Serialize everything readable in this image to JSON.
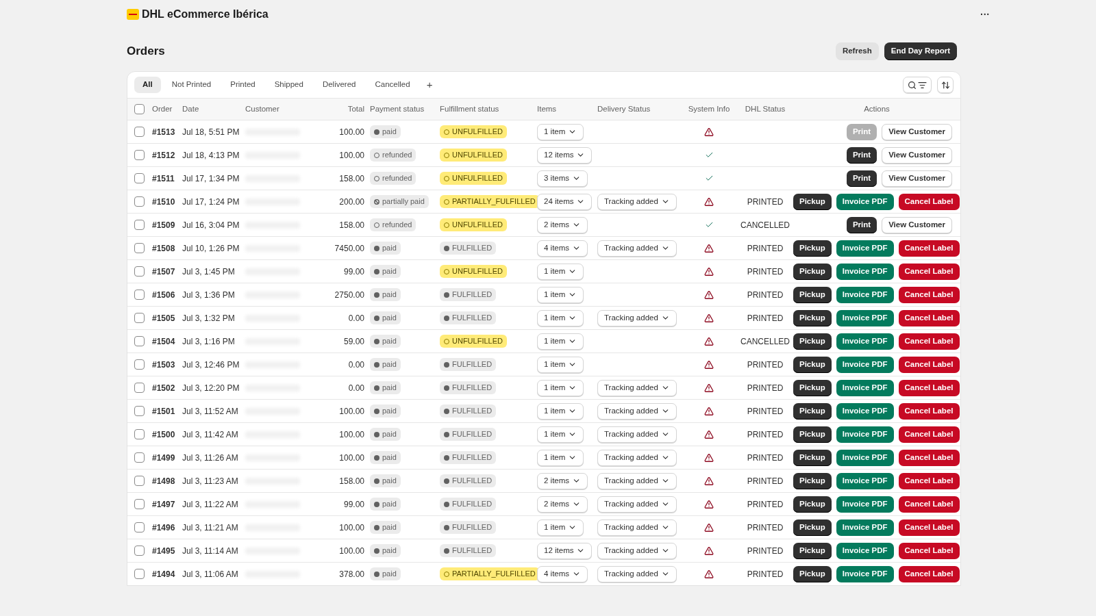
{
  "app": {
    "title": "DHL eCommerce Ibérica",
    "menu": "···"
  },
  "page": {
    "title": "Orders",
    "buttons": [
      {
        "label": "Refresh",
        "kind": "secondary"
      },
      {
        "label": "End Day Report",
        "kind": "primary"
      }
    ]
  },
  "tabs": [
    {
      "label": "All",
      "selected": true
    },
    {
      "label": "Not Printed",
      "selected": false
    },
    {
      "label": "Printed",
      "selected": false
    },
    {
      "label": "Shipped",
      "selected": false
    },
    {
      "label": "Delivered",
      "selected": false
    },
    {
      "label": "Cancelled",
      "selected": false
    }
  ],
  "add_tab": "+",
  "table": {
    "select_all": {
      "checked": false
    },
    "columns": [
      "Order",
      "Date",
      "Customer",
      "Total",
      "Payment status",
      "Fulfillment status",
      "Items",
      "Delivery Status",
      "System Info",
      "DHL Status",
      "Actions"
    ],
    "rows": [
      {
        "checked": false,
        "order": "#1513",
        "date": "Jul 18, 5:51 PM",
        "total": "100.00",
        "payment": {
          "label": "paid",
          "kind": "paid"
        },
        "fulfillment": {
          "label": "UNFULFILLED",
          "kind": "open"
        },
        "items": "1 item",
        "system_warning": true,
        "actions": [
          {
            "label": "Print",
            "kind": "print",
            "disabled": true
          },
          {
            "label": "View Customer",
            "kind": "outline",
            "disabled": false
          }
        ]
      },
      {
        "checked": false,
        "order": "#1512",
        "date": "Jul 18, 4:13 PM",
        "total": "100.00",
        "payment": {
          "label": "refunded",
          "kind": "refunded"
        },
        "fulfillment": {
          "label": "UNFULFILLED",
          "kind": "open"
        },
        "items": "12 items",
        "system_warning": false,
        "actions": [
          {
            "label": "Print",
            "kind": "print",
            "disabled": false
          },
          {
            "label": "View Customer",
            "kind": "outline",
            "disabled": false
          }
        ]
      },
      {
        "checked": false,
        "order": "#1511",
        "date": "Jul 17, 1:34 PM",
        "total": "158.00",
        "payment": {
          "label": "refunded",
          "kind": "refunded"
        },
        "fulfillment": {
          "label": "UNFULFILLED",
          "kind": "open"
        },
        "items": "3 items",
        "system_warning": false,
        "actions": [
          {
            "label": "Print",
            "kind": "print",
            "disabled": false
          },
          {
            "label": "View Customer",
            "kind": "outline",
            "disabled": false
          }
        ]
      },
      {
        "checked": false,
        "order": "#1510",
        "date": "Jul 17, 1:24 PM",
        "total": "200.00",
        "payment": {
          "label": "partially paid",
          "kind": "partial"
        },
        "fulfillment": {
          "label": "PARTIALLY_FULFILLED",
          "kind": "open"
        },
        "items": "24 items",
        "delivery": "Tracking added",
        "system_warning": true,
        "dhl_status": "PRINTED",
        "actions": [
          {
            "label": "Pickup",
            "kind": "dark",
            "disabled": false
          },
          {
            "label": "Invoice PDF",
            "kind": "green",
            "disabled": false
          },
          {
            "label": "Cancel Label",
            "kind": "red",
            "disabled": false
          }
        ]
      },
      {
        "checked": false,
        "order": "#1509",
        "date": "Jul 16, 3:04 PM",
        "total": "158.00",
        "payment": {
          "label": "refunded",
          "kind": "refunded"
        },
        "fulfillment": {
          "label": "UNFULFILLED",
          "kind": "open"
        },
        "items": "2 items",
        "system_warning": false,
        "dhl_status": "CANCELLED",
        "actions": [
          {
            "label": "Print",
            "kind": "print",
            "disabled": false
          },
          {
            "label": "View Customer",
            "kind": "outline",
            "disabled": false
          }
        ]
      },
      {
        "checked": false,
        "order": "#1508",
        "date": "Jul 10, 1:26 PM",
        "total": "7450.00",
        "payment": {
          "label": "paid",
          "kind": "paid"
        },
        "fulfillment": {
          "label": "FULFILLED",
          "kind": "done"
        },
        "items": "4 items",
        "delivery": "Tracking added",
        "system_warning": true,
        "dhl_status": "PRINTED",
        "actions": [
          {
            "label": "Pickup",
            "kind": "dark",
            "disabled": false
          },
          {
            "label": "Invoice PDF",
            "kind": "green",
            "disabled": false
          },
          {
            "label": "Cancel Label",
            "kind": "red",
            "disabled": false
          }
        ]
      },
      {
        "checked": false,
        "order": "#1507",
        "date": "Jul 3, 1:45 PM",
        "total": "99.00",
        "payment": {
          "label": "paid",
          "kind": "paid"
        },
        "fulfillment": {
          "label": "UNFULFILLED",
          "kind": "open"
        },
        "items": "1 item",
        "system_warning": true,
        "dhl_status": "PRINTED",
        "actions": [
          {
            "label": "Pickup",
            "kind": "dark",
            "disabled": false
          },
          {
            "label": "Invoice PDF",
            "kind": "green",
            "disabled": false
          },
          {
            "label": "Cancel Label",
            "kind": "red",
            "disabled": false
          }
        ]
      },
      {
        "checked": false,
        "order": "#1506",
        "date": "Jul 3, 1:36 PM",
        "total": "2750.00",
        "payment": {
          "label": "paid",
          "kind": "paid"
        },
        "fulfillment": {
          "label": "FULFILLED",
          "kind": "done"
        },
        "items": "1 item",
        "system_warning": true,
        "dhl_status": "PRINTED",
        "actions": [
          {
            "label": "Pickup",
            "kind": "dark",
            "disabled": false
          },
          {
            "label": "Invoice PDF",
            "kind": "green",
            "disabled": false
          },
          {
            "label": "Cancel Label",
            "kind": "red",
            "disabled": false
          }
        ]
      },
      {
        "checked": false,
        "order": "#1505",
        "date": "Jul 3, 1:32 PM",
        "total": "0.00",
        "payment": {
          "label": "paid",
          "kind": "paid"
        },
        "fulfillment": {
          "label": "FULFILLED",
          "kind": "done"
        },
        "items": "1 item",
        "delivery": "Tracking added",
        "system_warning": true,
        "dhl_status": "PRINTED",
        "actions": [
          {
            "label": "Pickup",
            "kind": "dark",
            "disabled": false
          },
          {
            "label": "Invoice PDF",
            "kind": "green",
            "disabled": false
          },
          {
            "label": "Cancel Label",
            "kind": "red",
            "disabled": false
          }
        ]
      },
      {
        "checked": false,
        "order": "#1504",
        "date": "Jul 3, 1:16 PM",
        "total": "59.00",
        "payment": {
          "label": "paid",
          "kind": "paid"
        },
        "fulfillment": {
          "label": "UNFULFILLED",
          "kind": "open"
        },
        "items": "1 item",
        "system_warning": true,
        "dhl_status": "CANCELLED",
        "actions": [
          {
            "label": "Pickup",
            "kind": "dark",
            "disabled": false
          },
          {
            "label": "Invoice PDF",
            "kind": "green",
            "disabled": false
          },
          {
            "label": "Cancel Label",
            "kind": "red",
            "disabled": false
          }
        ]
      },
      {
        "checked": false,
        "order": "#1503",
        "date": "Jul 3, 12:46 PM",
        "total": "0.00",
        "payment": {
          "label": "paid",
          "kind": "paid"
        },
        "fulfillment": {
          "label": "FULFILLED",
          "kind": "done"
        },
        "items": "1 item",
        "system_warning": true,
        "dhl_status": "PRINTED",
        "actions": [
          {
            "label": "Pickup",
            "kind": "dark",
            "disabled": false
          },
          {
            "label": "Invoice PDF",
            "kind": "green",
            "disabled": false
          },
          {
            "label": "Cancel Label",
            "kind": "red",
            "disabled": false
          }
        ]
      },
      {
        "checked": false,
        "order": "#1502",
        "date": "Jul 3, 12:20 PM",
        "total": "0.00",
        "payment": {
          "label": "paid",
          "kind": "paid"
        },
        "fulfillment": {
          "label": "FULFILLED",
          "kind": "done"
        },
        "items": "1 item",
        "delivery": "Tracking added",
        "system_warning": true,
        "dhl_status": "PRINTED",
        "actions": [
          {
            "label": "Pickup",
            "kind": "dark",
            "disabled": false
          },
          {
            "label": "Invoice PDF",
            "kind": "green",
            "disabled": false
          },
          {
            "label": "Cancel Label",
            "kind": "red",
            "disabled": false
          }
        ]
      },
      {
        "checked": false,
        "order": "#1501",
        "date": "Jul 3, 11:52 AM",
        "total": "100.00",
        "payment": {
          "label": "paid",
          "kind": "paid"
        },
        "fulfillment": {
          "label": "FULFILLED",
          "kind": "done"
        },
        "items": "1 item",
        "delivery": "Tracking added",
        "system_warning": true,
        "dhl_status": "PRINTED",
        "actions": [
          {
            "label": "Pickup",
            "kind": "dark",
            "disabled": false
          },
          {
            "label": "Invoice PDF",
            "kind": "green",
            "disabled": false
          },
          {
            "label": "Cancel Label",
            "kind": "red",
            "disabled": false
          }
        ]
      },
      {
        "checked": false,
        "order": "#1500",
        "date": "Jul 3, 11:42 AM",
        "total": "100.00",
        "payment": {
          "label": "paid",
          "kind": "paid"
        },
        "fulfillment": {
          "label": "FULFILLED",
          "kind": "done"
        },
        "items": "1 item",
        "delivery": "Tracking added",
        "system_warning": true,
        "dhl_status": "PRINTED",
        "actions": [
          {
            "label": "Pickup",
            "kind": "dark",
            "disabled": false
          },
          {
            "label": "Invoice PDF",
            "kind": "green",
            "disabled": false
          },
          {
            "label": "Cancel Label",
            "kind": "red",
            "disabled": false
          }
        ]
      },
      {
        "checked": false,
        "order": "#1499",
        "date": "Jul 3, 11:26 AM",
        "total": "100.00",
        "payment": {
          "label": "paid",
          "kind": "paid"
        },
        "fulfillment": {
          "label": "FULFILLED",
          "kind": "done"
        },
        "items": "1 item",
        "delivery": "Tracking added",
        "system_warning": true,
        "dhl_status": "PRINTED",
        "actions": [
          {
            "label": "Pickup",
            "kind": "dark",
            "disabled": false
          },
          {
            "label": "Invoice PDF",
            "kind": "green",
            "disabled": false
          },
          {
            "label": "Cancel Label",
            "kind": "red",
            "disabled": false
          }
        ]
      },
      {
        "checked": false,
        "order": "#1498",
        "date": "Jul 3, 11:23 AM",
        "total": "158.00",
        "payment": {
          "label": "paid",
          "kind": "paid"
        },
        "fulfillment": {
          "label": "FULFILLED",
          "kind": "done"
        },
        "items": "2 items",
        "delivery": "Tracking added",
        "system_warning": true,
        "dhl_status": "PRINTED",
        "actions": [
          {
            "label": "Pickup",
            "kind": "dark",
            "disabled": false
          },
          {
            "label": "Invoice PDF",
            "kind": "green",
            "disabled": false
          },
          {
            "label": "Cancel Label",
            "kind": "red",
            "disabled": false
          }
        ]
      },
      {
        "checked": false,
        "order": "#1497",
        "date": "Jul 3, 11:22 AM",
        "total": "99.00",
        "payment": {
          "label": "paid",
          "kind": "paid"
        },
        "fulfillment": {
          "label": "FULFILLED",
          "kind": "done"
        },
        "items": "2 items",
        "delivery": "Tracking added",
        "system_warning": true,
        "dhl_status": "PRINTED",
        "actions": [
          {
            "label": "Pickup",
            "kind": "dark",
            "disabled": false
          },
          {
            "label": "Invoice PDF",
            "kind": "green",
            "disabled": false
          },
          {
            "label": "Cancel Label",
            "kind": "red",
            "disabled": false
          }
        ]
      },
      {
        "checked": false,
        "order": "#1496",
        "date": "Jul 3, 11:21 AM",
        "total": "100.00",
        "payment": {
          "label": "paid",
          "kind": "paid"
        },
        "fulfillment": {
          "label": "FULFILLED",
          "kind": "done"
        },
        "items": "1 item",
        "delivery": "Tracking added",
        "system_warning": true,
        "dhl_status": "PRINTED",
        "actions": [
          {
            "label": "Pickup",
            "kind": "dark",
            "disabled": false
          },
          {
            "label": "Invoice PDF",
            "kind": "green",
            "disabled": false
          },
          {
            "label": "Cancel Label",
            "kind": "red",
            "disabled": false
          }
        ]
      },
      {
        "checked": false,
        "order": "#1495",
        "date": "Jul 3, 11:14 AM",
        "total": "100.00",
        "payment": {
          "label": "paid",
          "kind": "paid"
        },
        "fulfillment": {
          "label": "FULFILLED",
          "kind": "done"
        },
        "items": "12 items",
        "delivery": "Tracking added",
        "system_warning": true,
        "dhl_status": "PRINTED",
        "actions": [
          {
            "label": "Pickup",
            "kind": "dark",
            "disabled": false
          },
          {
            "label": "Invoice PDF",
            "kind": "green",
            "disabled": false
          },
          {
            "label": "Cancel Label",
            "kind": "red",
            "disabled": false
          }
        ]
      },
      {
        "checked": false,
        "order": "#1494",
        "date": "Jul 3, 11:06 AM",
        "total": "378.00",
        "payment": {
          "label": "paid",
          "kind": "paid"
        },
        "fulfillment": {
          "label": "PARTIALLY_FULFILLED",
          "kind": "open"
        },
        "items": "4 items",
        "delivery": "Tracking added",
        "system_warning": true,
        "dhl_status": "PRINTED",
        "actions": [
          {
            "label": "Pickup",
            "kind": "dark",
            "disabled": false
          },
          {
            "label": "Invoice PDF",
            "kind": "green",
            "disabled": false
          },
          {
            "label": "Cancel Label",
            "kind": "red",
            "disabled": false
          }
        ]
      }
    ]
  }
}
